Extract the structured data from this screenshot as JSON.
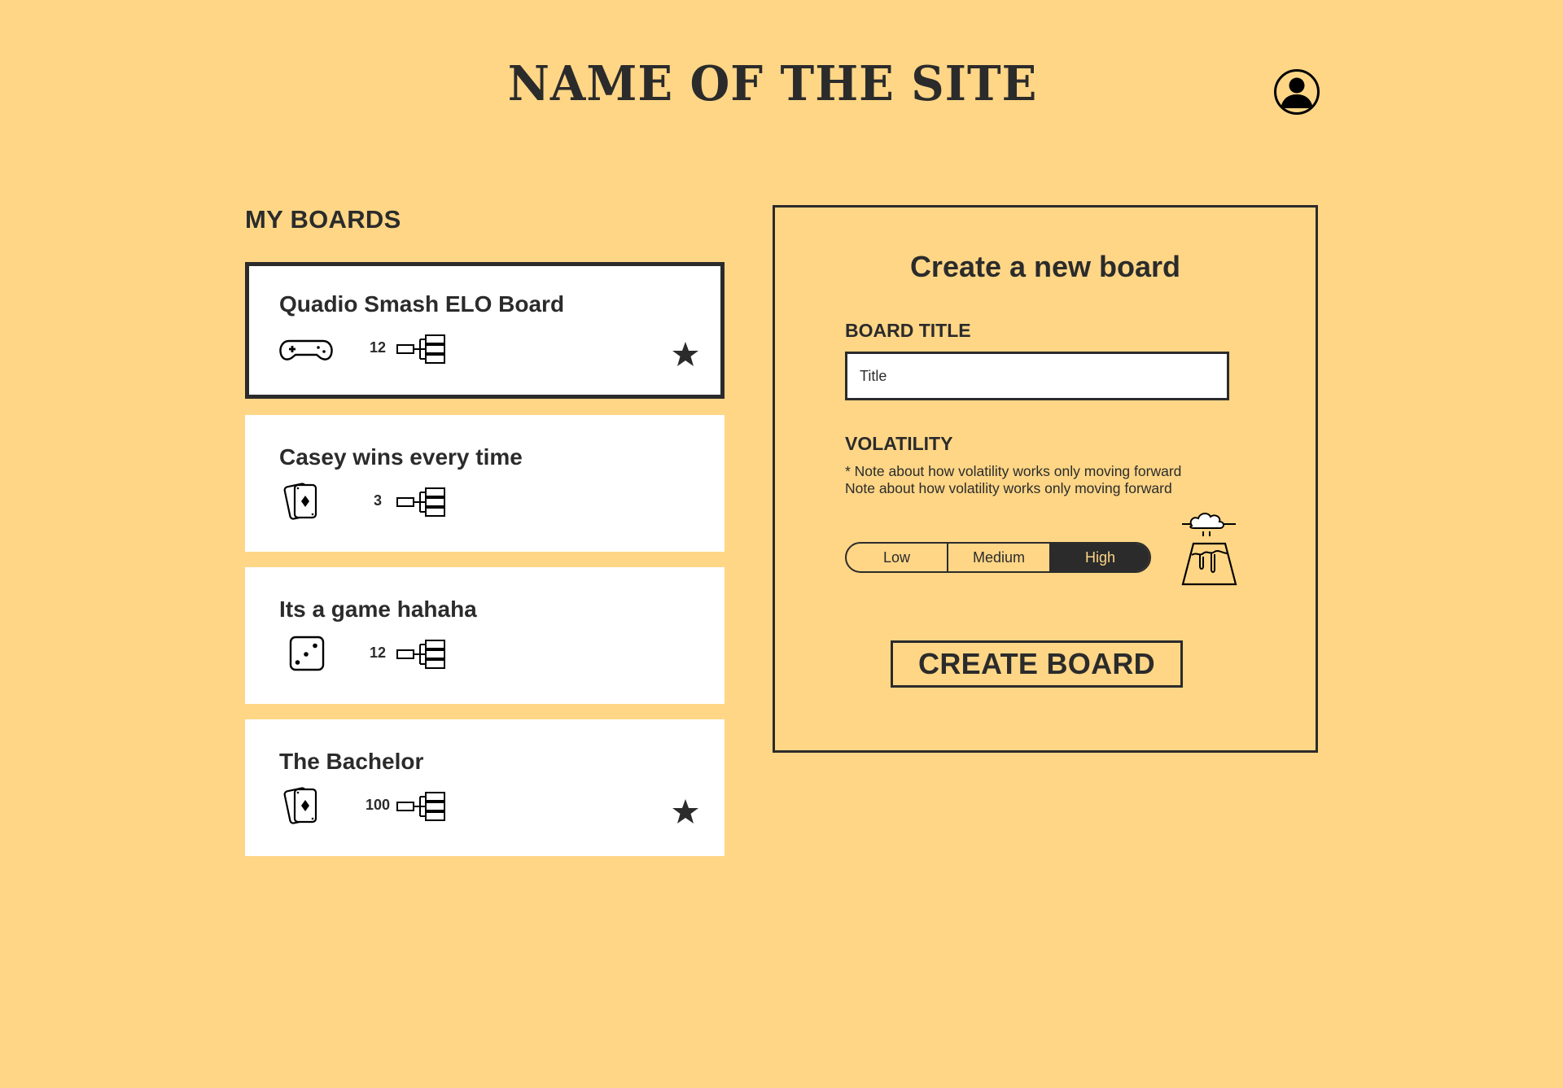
{
  "header": {
    "site_title": "NAME OF THE SITE",
    "account_icon": "user-circle-icon"
  },
  "boards": {
    "heading": "MY BOARDS",
    "items": [
      {
        "title": "Quadio Smash ELO Board",
        "game_icon": "gamepad-icon",
        "player_count": "12",
        "favorite": true,
        "selected": true
      },
      {
        "title": "Casey wins every time",
        "game_icon": "playing-cards-icon",
        "player_count": "3",
        "favorite": false,
        "selected": false
      },
      {
        "title": "Its a game hahaha",
        "game_icon": "dice-icon",
        "player_count": "12",
        "favorite": false,
        "selected": false
      },
      {
        "title": "The Bachelor",
        "game_icon": "playing-cards-icon",
        "player_count": "100",
        "favorite": true,
        "selected": false
      }
    ]
  },
  "create_board": {
    "heading": "Create a new board",
    "title_label": "BOARD TITLE",
    "title_placeholder": "Title",
    "title_value": "",
    "volatility_label": "VOLATILITY",
    "volatility_note_1": "* Note about how volatility works only moving forward",
    "volatility_note_2": "Note about how volatility works only moving forward",
    "volatility_options": [
      "Low",
      "Medium",
      "High"
    ],
    "volatility_selected": "High",
    "volatility_icon": "volcano-icon",
    "submit_label": "CREATE BOARD"
  },
  "colors": {
    "background": "#FED686",
    "ink": "#2b2b2b",
    "card": "#ffffff"
  }
}
